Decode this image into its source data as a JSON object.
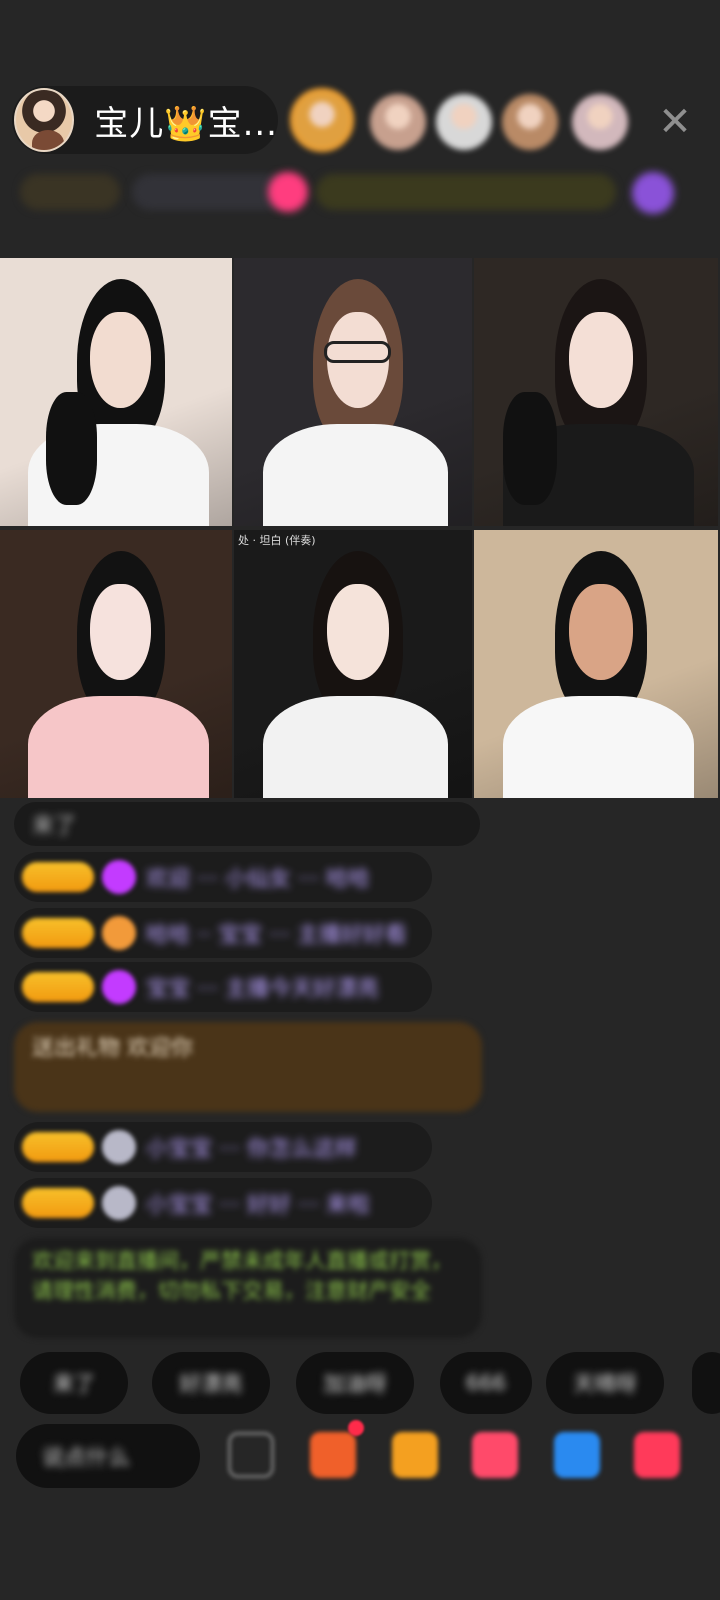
{
  "header": {
    "host_name": "宝儿👑宝...",
    "close_glyph": "✕"
  },
  "viewers": [
    {
      "color": "#e0a040",
      "highlight": true
    },
    {
      "color": "#c7a08e"
    },
    {
      "color": "#d8d8d8"
    },
    {
      "color": "#b98a66"
    },
    {
      "color": "#d2b8bc"
    }
  ],
  "video_tiles": [
    {
      "name": "guest-tile-1",
      "bg": "#e9ddd5",
      "skin": "#f2dcd0",
      "hair": "#111111",
      "top": "#f5f5f5"
    },
    {
      "name": "guest-tile-2",
      "bg": "#2c2a2e",
      "skin": "#f3ddd3",
      "hair": "#6a4a3a",
      "top": "#f4f4f4",
      "glasses": true
    },
    {
      "name": "guest-tile-3",
      "bg": "#2e2824",
      "skin": "#f4dfd6",
      "hair": "#1b1514",
      "top": "#1a1a1a"
    },
    {
      "name": "guest-tile-4",
      "bg": "#3a2a22",
      "skin": "#f6e2dd",
      "hair": "#121212",
      "top": "#f6c6c8",
      "caption": ""
    },
    {
      "name": "guest-tile-5",
      "bg": "#1a1a1a",
      "skin": "#f5e3da",
      "hair": "#171210",
      "top": "#f2f2f2",
      "caption": "处 · 坦白 (伴奏)"
    },
    {
      "name": "guest-tile-6",
      "bg": "#cdb79b",
      "skin": "#d9a486",
      "hair": "#121212",
      "top": "#f7f7f7"
    }
  ],
  "chat": {
    "system_text": "欢迎来到直播间，严禁未成年人直播或打赏，请理性消费，切勿私下交易，注意财产安全",
    "fan_text": "送出礼物 欢迎你",
    "messages": [
      {
        "text": "来了",
        "badge": "",
        "icon_color": "none"
      },
      {
        "text": "欢迎 ··· 小仙女 ··· 哈哈",
        "badge": "",
        "icon_color": "#c33bff"
      },
      {
        "text": "哈哈 ·· 宝宝 ··· 主播好好看",
        "badge": "",
        "icon_color": "#f29a3a"
      },
      {
        "text": "宝宝 ··· 主播今天好漂亮",
        "badge": "",
        "icon_color": "#c33bff"
      },
      {
        "text": "小宝宝 ··· 你怎么这样",
        "badge": "",
        "icon_color": "#b8b8c8"
      },
      {
        "text": "小宝宝 ··· 好好 ··· 来啦",
        "badge": "",
        "icon_color": "#b8b8c8"
      }
    ]
  },
  "quick_replies": [
    "来了",
    "好漂亮",
    "加油呀",
    "666",
    "天晴呀"
  ],
  "toolbar": {
    "input_placeholder": "说点什么",
    "tools": [
      {
        "name": "more-icon",
        "color": "#555555"
      },
      {
        "name": "gift-box-icon",
        "color": "#f0602a"
      },
      {
        "name": "treasure-icon",
        "color": "#f4a020"
      },
      {
        "name": "pk-icon",
        "color": "#ff4a6a"
      },
      {
        "name": "game-icon",
        "color": "#2a8af0"
      },
      {
        "name": "activity-icon",
        "color": "#ff3a5a"
      }
    ]
  },
  "colors": {
    "background": "#262626",
    "panel": "#1c1c1c",
    "badge_gold": "#f7c02a",
    "system_green": "#8bc34a"
  }
}
